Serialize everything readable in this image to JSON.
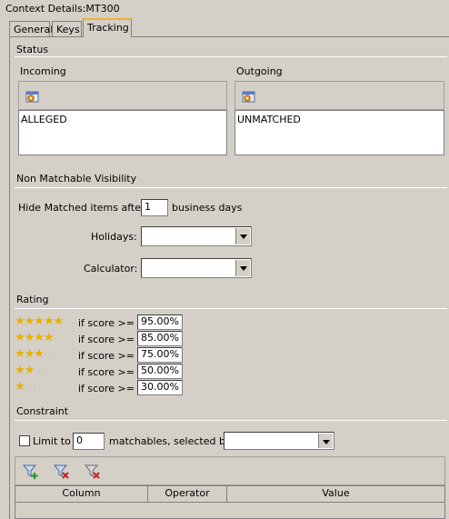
{
  "window": {
    "title": "Context Details:MT300"
  },
  "tabs": [
    {
      "label": "General"
    },
    {
      "label": "Keys"
    },
    {
      "label": "Tracking"
    }
  ],
  "status": {
    "heading": "Status",
    "incoming": {
      "label": "Incoming",
      "value": "ALLEGED",
      "icon": "settings-icon"
    },
    "outgoing": {
      "label": "Outgoing",
      "value": "UNMATCHED",
      "icon": "settings-icon"
    }
  },
  "visibility": {
    "heading": "Non Matchable Visibility",
    "hide_label": "Hide Matched items after:",
    "hide_value": "1",
    "hide_suffix": "business days",
    "holidays_label": "Holidays:",
    "holidays_value": "",
    "calculator_label": "Calculator:",
    "calculator_value": ""
  },
  "rating": {
    "heading": "Rating",
    "rows": [
      {
        "stars": 5,
        "label": "if score >=",
        "value": "95.00%"
      },
      {
        "stars": 4,
        "label": "if score >=",
        "value": "85.00%"
      },
      {
        "stars": 3,
        "label": "if score >=",
        "value": "75.00%"
      },
      {
        "stars": 2,
        "label": "if score >=",
        "value": "50.00%"
      },
      {
        "stars": 1,
        "label": "if score >=",
        "value": "30.00%"
      }
    ]
  },
  "constraint": {
    "heading": "Constraint",
    "limit_label": "Limit to",
    "limit_checked": false,
    "limit_value": "0",
    "selected_by_label": "matchables, selected by:",
    "selected_by_value": "",
    "table_columns": [
      "Column",
      "Operator",
      "Value"
    ]
  },
  "colors": {
    "background": "#d4d0c8",
    "star": "#e8b000",
    "active_tab_accent": "#f0b030"
  }
}
